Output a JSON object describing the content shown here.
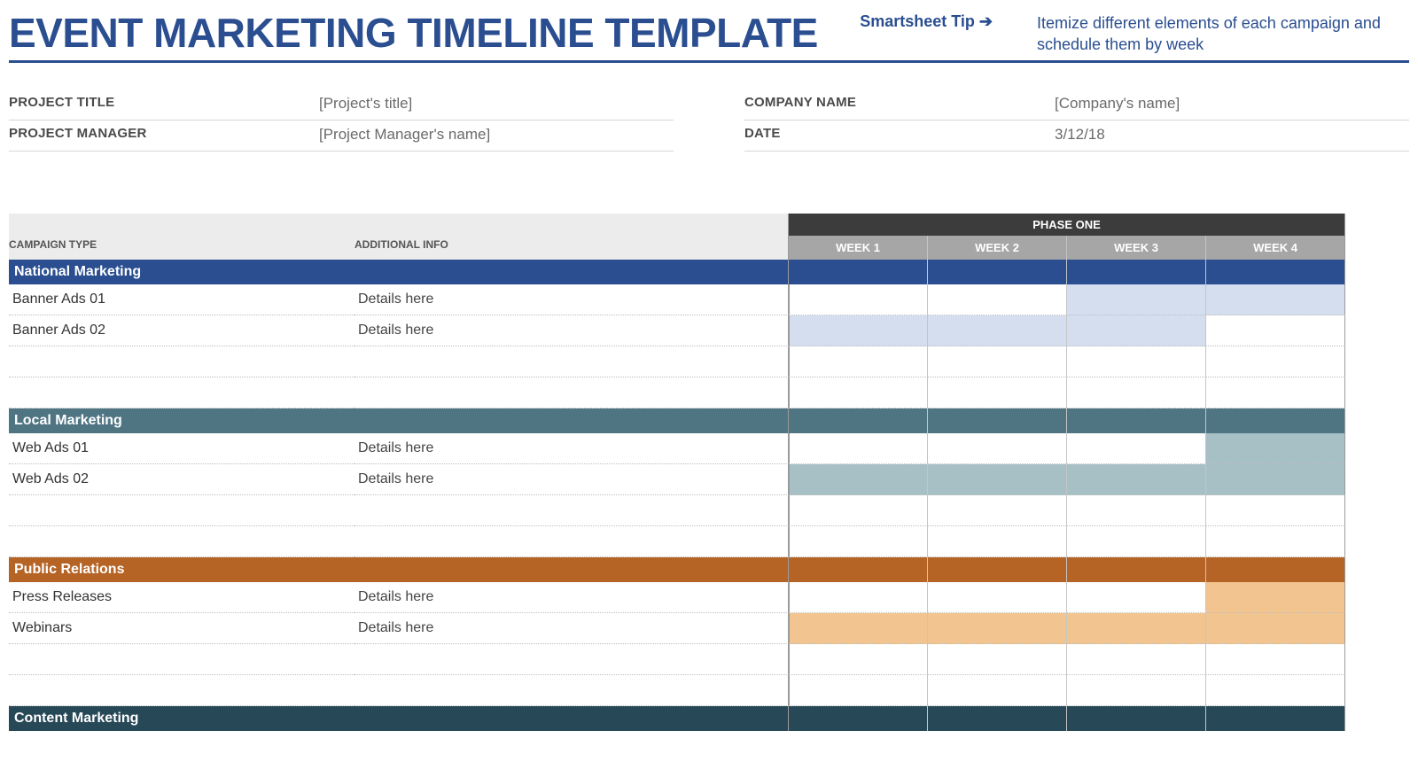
{
  "header": {
    "title": "EVENT MARKETING TIMELINE TEMPLATE",
    "tip_label": "Smartsheet Tip ➔",
    "tip_text": "Itemize different elements of each campaign and schedule them by week"
  },
  "meta": {
    "project_title_label": "PROJECT TITLE",
    "project_title_value": "[Project's title]",
    "project_manager_label": "PROJECT MANAGER",
    "project_manager_value": "[Project Manager's name]",
    "company_name_label": "COMPANY NAME",
    "company_name_value": "[Company's name]",
    "date_label": "DATE",
    "date_value": "3/12/18"
  },
  "columns": {
    "campaign_type": "CAMPAIGN TYPE",
    "additional_info": "ADDITIONAL INFO",
    "phase_one": "PHASE ONE",
    "weeks": [
      "WEEK 1",
      "WEEK 2",
      "WEEK 3",
      "WEEK 4"
    ]
  },
  "categories": [
    {
      "name": "National Marketing",
      "color": "bg-national",
      "fill": "fill-nat",
      "rows": [
        {
          "campaign": "Banner Ads 01",
          "info": "Details here",
          "weeks": [
            0,
            0,
            1,
            1
          ]
        },
        {
          "campaign": "Banner Ads 02",
          "info": "Details here",
          "weeks": [
            1,
            1,
            1,
            0
          ]
        },
        {
          "campaign": "",
          "info": "",
          "weeks": [
            0,
            0,
            0,
            0
          ]
        },
        {
          "campaign": "",
          "info": "",
          "weeks": [
            0,
            0,
            0,
            0
          ]
        }
      ]
    },
    {
      "name": "Local Marketing",
      "color": "bg-local",
      "fill": "fill-loc",
      "rows": [
        {
          "campaign": "Web Ads 01",
          "info": "Details here",
          "weeks": [
            0,
            0,
            0,
            1
          ]
        },
        {
          "campaign": "Web Ads 02",
          "info": "Details here",
          "weeks": [
            1,
            1,
            1,
            1
          ]
        },
        {
          "campaign": "",
          "info": "",
          "weeks": [
            0,
            0,
            0,
            0
          ]
        },
        {
          "campaign": "",
          "info": "",
          "weeks": [
            0,
            0,
            0,
            0
          ]
        }
      ]
    },
    {
      "name": "Public Relations",
      "color": "bg-pr",
      "fill": "fill-pr",
      "rows": [
        {
          "campaign": "Press Releases",
          "info": "Details here",
          "weeks": [
            0,
            0,
            0,
            1
          ]
        },
        {
          "campaign": "Webinars",
          "info": "Details here",
          "weeks": [
            1,
            1,
            1,
            1
          ]
        },
        {
          "campaign": "",
          "info": "",
          "weeks": [
            0,
            0,
            0,
            0
          ]
        },
        {
          "campaign": "",
          "info": "",
          "weeks": [
            0,
            0,
            0,
            0
          ]
        }
      ]
    },
    {
      "name": "Content Marketing",
      "color": "bg-content",
      "fill": "",
      "rows": []
    }
  ]
}
